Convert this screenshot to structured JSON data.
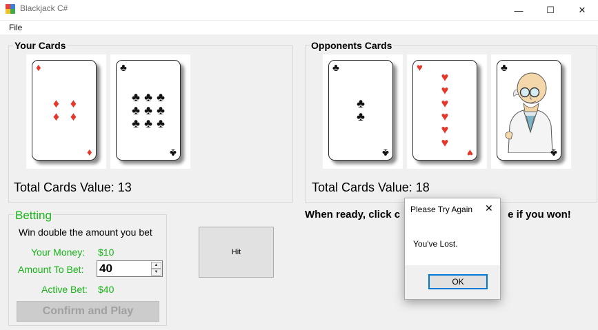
{
  "window": {
    "title": "Blackjack C#",
    "minimize_glyph": "—",
    "maximize_glyph": "☐",
    "close_glyph": "✕"
  },
  "menu": {
    "file": "File"
  },
  "your_cards": {
    "title": "Your Cards",
    "total_label": "Total Cards Value: 13",
    "cards": [
      {
        "rank": "4",
        "suit": "♦",
        "color": "red"
      },
      {
        "rank": "9",
        "suit": "♣",
        "color": "black"
      }
    ]
  },
  "opponent_cards": {
    "title": "Opponents Cards",
    "total_label": "Total Cards Value: 18",
    "cards": [
      {
        "rank": "2",
        "suit": "♣",
        "color": "black"
      },
      {
        "rank": "6",
        "suit": "♥",
        "color": "red"
      },
      {
        "rank": "K",
        "suit": "♣",
        "color": "black",
        "face": "Professor Farnsworth illustration"
      }
    ]
  },
  "betting": {
    "title": "Betting",
    "subtitle": "Win double the amount you bet",
    "money_label": "Your Money:",
    "money_value": "$10",
    "amount_label": "Amount To Bet:",
    "amount_value": "40",
    "active_label": "Active Bet:",
    "active_value": "$40",
    "confirm_button": "Confirm and Play"
  },
  "hit_button": "Hit",
  "ready_text": "When ready, click c",
  "ready_text_tail": "e if you won!",
  "dialog": {
    "title": "Please Try Again",
    "message": "You've Lost.",
    "ok_button": "OK",
    "close_glyph": "✕"
  },
  "colors": {
    "accent_green": "#16b316",
    "heart_diamond_red": "#e5372a",
    "focus_blue": "#0078d7"
  }
}
